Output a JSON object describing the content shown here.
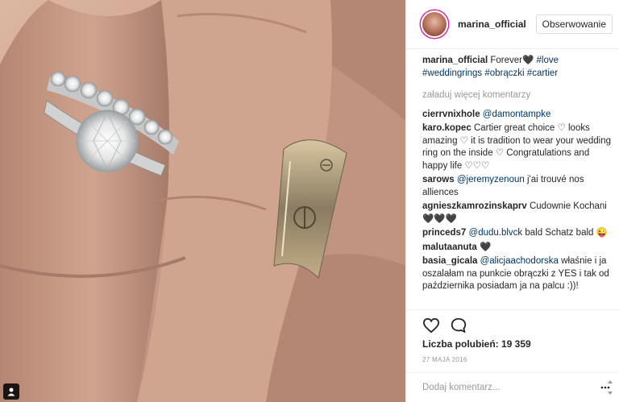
{
  "header": {
    "username": "marina_official",
    "follow_label": "Obserwowanie"
  },
  "caption": {
    "user": "marina_official",
    "text": "Forever🖤",
    "tags": [
      "#love",
      "#weddingrings",
      "#obrączki",
      "#cartier"
    ]
  },
  "load_more_label": "załaduj więcej komentarzy",
  "comments": [
    {
      "user": "cierrvnixhole",
      "mention": "@damontampke",
      "text": ""
    },
    {
      "user": "karo.kopec",
      "mention": "",
      "text": "Cartier great choice ♡ looks amazing ♡ it is tradition to wear your wedding ring on the inside ♡ Congratulations and happy life ♡♡♡"
    },
    {
      "user": "sarows",
      "mention": "@jeremyzenoun",
      "text": "j'ai trouvé nos alliences"
    },
    {
      "user": "agnieszkamrozinskaprv",
      "mention": "",
      "text": "Cudownie Kochani 🖤🖤🖤"
    },
    {
      "user": "princeds7",
      "mention": "@dudu.blvck",
      "text": "bald Schatz bald 😜"
    },
    {
      "user": "malutaanuta",
      "mention": "",
      "text": "🖤"
    },
    {
      "user": "basia_gicala",
      "mention": "@alicjaachodorska",
      "text": "właśnie i ja oszalałam na punkcie obrączki z YES i tak od października posiadam ja na palcu :))!"
    }
  ],
  "icons": {
    "like": "heart-icon",
    "comment": "comment-bubble-icon",
    "more": "more-options-icon",
    "photo_badge": "user-tag-icon"
  },
  "likes_text": "Liczba polubień: 19 359",
  "date_text": "27 MAJA 2016",
  "add_comment_placeholder": "Dodaj komentarz...",
  "colors": {
    "link": "#003569",
    "muted": "#999999",
    "border": "#efefef"
  }
}
